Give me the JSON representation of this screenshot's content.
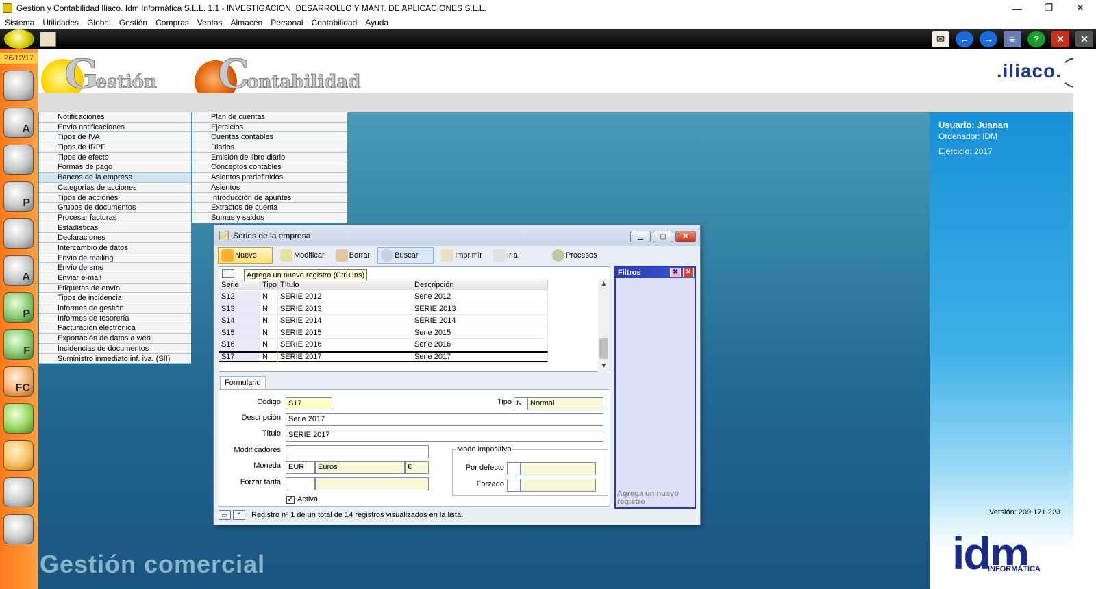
{
  "window": {
    "title": "Gestión y Contabilidad Iliaco. Idm Informática S.L.L. 1.1 - INVESTIGACION, DESARROLLO Y MANT. DE APLICACIONES S.L.L.",
    "minimize": "—",
    "restore": "❐",
    "close": "✕"
  },
  "menubar": [
    "Sistema",
    "Utilidades",
    "Global",
    "Gestión",
    "Compras",
    "Ventas",
    "Almacén",
    "Personal",
    "Contabilidad",
    "Ayuda"
  ],
  "toolbar": {
    "right_icons": [
      "mail-icon",
      "back-icon",
      "forward-icon",
      "windows-icon",
      "help-icon",
      "close-icon",
      "close-all-icon"
    ]
  },
  "leftbar": {
    "date": "26/12/17",
    "icons": [
      "users-icon",
      "articles-icon",
      "client-icon",
      "provider-icon",
      "employees-icon",
      "agent-icon",
      "p-icon",
      "f-icon",
      "fc-icon",
      "shopping-bag-green-icon",
      "shopping-bag-orange-icon",
      "notebook-icon",
      "cd-icon"
    ],
    "icon_letters": [
      "",
      "A",
      "",
      "P",
      "",
      "A",
      "P",
      "F",
      "FC",
      "",
      "",
      "",
      ""
    ]
  },
  "header": {
    "logo1_big": "G",
    "logo1_small": "estión",
    "logo2_big": "C",
    "logo2_small": "ontabilidad",
    "brand": ".iliaco."
  },
  "menu_gestion": [
    "Notificaciones",
    "Envío notificaciones",
    "Tipos de IVA",
    "Tipos de IRPF",
    "Tipos de efecto",
    "Formas de pago",
    "Bancos de la empresa",
    "Categorías de acciones",
    "Tipos de acciones",
    "Grupos de documentos",
    "Procesar facturas",
    "Estadísticas",
    "Declaraciones",
    "Intercambio de datos",
    "Envío de mailing",
    "Envío de sms",
    "Enviar e-mail",
    "Etiquetas de envío",
    "Tipos de incidencia",
    "Informes de gestión",
    "Informes de tesorería",
    "Facturación electrónica",
    "Exportación de datos a web",
    "Incidencias de documentos",
    "Suministro inmediato inf. iva. (SII)"
  ],
  "menu_contabilidad": [
    "Plan de cuentas",
    "Ejercicios",
    "Cuentas contables",
    "Diarios",
    "Emisión de libro diario",
    "Conceptos contables",
    "Asientos predefinidos",
    "Asientos",
    "Introducción de apuntes",
    "Extractos de cuenta",
    "Sumas y saldos"
  ],
  "background_text": "Gestión comercial",
  "right_panel": {
    "user": "Usuario: Juanan",
    "computer": "Ordenador: IDM",
    "year": "Ejercicio: 2017",
    "version": "Versión: 209 171.223",
    "idm": "idm",
    "idm_sub": "INFORMÁTICA"
  },
  "dialog": {
    "title": "Series de la empresa",
    "buttons": {
      "nuevo": "Nuevo",
      "modificar": "Modificar",
      "borrar": "Borrar",
      "buscar": "Buscar",
      "imprimir": "Imprimir",
      "ir_a": "Ir a",
      "procesos": "Procesos"
    },
    "tooltip": "Agrega un nuevo registro (Ctrl+Ins)",
    "columns": [
      "Serie",
      "Tipo",
      "Título",
      "Descripción"
    ],
    "rows": [
      {
        "serie": "S12",
        "tipo": "N",
        "titulo": "SERIE 2012",
        "descripcion": "Serie 2012"
      },
      {
        "serie": "S13",
        "tipo": "N",
        "titulo": "SERIE 2013",
        "descripcion": "SERIE 2013"
      },
      {
        "serie": "S14",
        "tipo": "N",
        "titulo": "SERIE 2014",
        "descripcion": "SERIE 2014"
      },
      {
        "serie": "S15",
        "tipo": "N",
        "titulo": "SERIE 2015",
        "descripcion": "Serie 2015"
      },
      {
        "serie": "S16",
        "tipo": "N",
        "titulo": "SERIE 2016",
        "descripcion": "Serie 2016"
      },
      {
        "serie": "S17",
        "tipo": "N",
        "titulo": "SERIE 2017",
        "descripcion": "Serie 2017"
      }
    ],
    "filters": {
      "title": "Filtros",
      "footer": "Agrega un nuevo registro"
    },
    "tab": "Formulario",
    "form": {
      "codigo_label": "Código",
      "codigo_value": "S17",
      "tipo_label": "Tipo",
      "tipo_code": "N",
      "tipo_value": "Normal",
      "descripcion_label": "Descripción",
      "descripcion_value": "Serie 2017",
      "titulo_label": "Título",
      "titulo_value": "SERIE 2017",
      "modificadores_label": "Modificadores",
      "modificadores_value": "",
      "moneda_label": "Moneda",
      "moneda_code": "EUR",
      "moneda_name": "Euros",
      "moneda_symbol": "€",
      "forzar_label": "Forzar tarifa",
      "forzar_code": "",
      "forzar_name": "",
      "modo_legend": "Modo impositivo",
      "por_defecto_label": "Por defecto",
      "forzado_label": "Forzado",
      "activa_label": "Activa",
      "activa_checked": true
    },
    "status": "Registro nº 1 de un total de 14 registros visualizados en la lista."
  }
}
